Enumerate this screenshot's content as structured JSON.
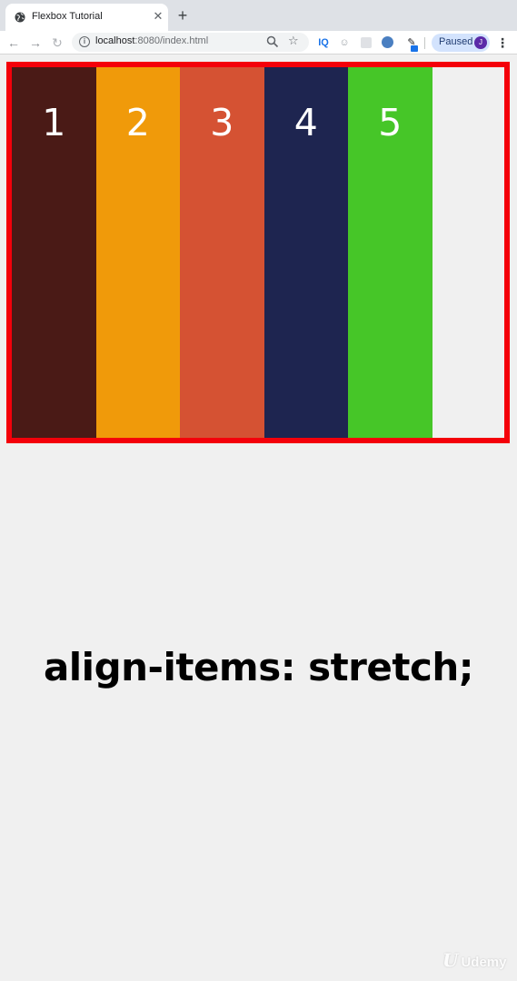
{
  "browser": {
    "tab": {
      "title": "Flexbox Tutorial",
      "close_glyph": "✕"
    },
    "new_tab_glyph": "+",
    "toolbar": {
      "back_glyph": "←",
      "forward_glyph": "→",
      "reload_glyph": "↻",
      "url_host": "localhost",
      "url_rest": ":8080/index.html",
      "star_glyph": "☆",
      "extension_iq": "IQ",
      "extension_ghost": "☺",
      "extension_pen": "✎",
      "profile_label": "Paused",
      "profile_initial": "J",
      "menu_glyph": "⋮"
    }
  },
  "page": {
    "items": [
      {
        "label": "1",
        "color": "#4a1a16"
      },
      {
        "label": "2",
        "color": "#f09a0a"
      },
      {
        "label": "3",
        "color": "#d55233"
      },
      {
        "label": "4",
        "color": "#1e2550"
      },
      {
        "label": "5",
        "color": "#46c628"
      }
    ],
    "container_border_color": "#f4000a",
    "caption": "align-items: stretch;",
    "watermark": {
      "mark": "U",
      "text": "Udemy"
    }
  }
}
